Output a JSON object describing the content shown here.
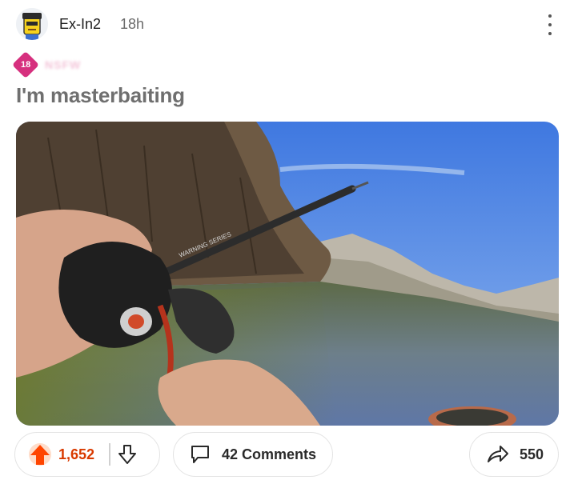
{
  "post": {
    "author": "Ex-In2",
    "age": "18h",
    "nsfw_badge": "18",
    "flair_text": "NSFW",
    "title": "I'm masterbaiting"
  },
  "actions": {
    "score": "1,652",
    "comments_label": "42 Comments",
    "shares": "550"
  },
  "media": {
    "rod_text": "WARNING SERIES"
  },
  "colors": {
    "upvote": "#ff4500",
    "score": "#d93a00",
    "nsfw": "#d6307e"
  },
  "icons": [
    "avatar-icon",
    "more-options-icon",
    "upvote-icon",
    "downvote-icon",
    "comment-icon",
    "share-icon"
  ]
}
